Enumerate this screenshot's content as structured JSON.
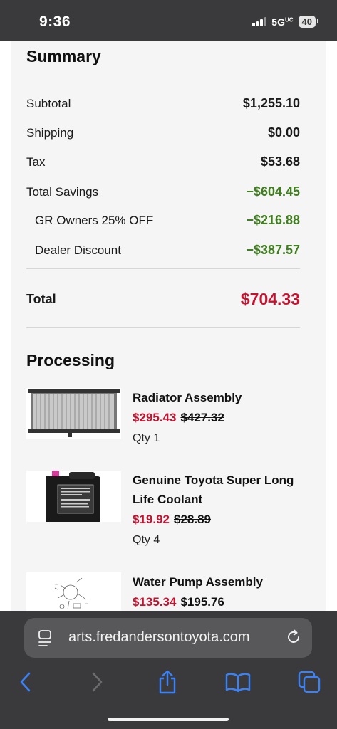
{
  "status_bar": {
    "time": "9:36",
    "network": "5G",
    "network_sup": "UC",
    "battery": "40"
  },
  "summary": {
    "title": "Summary",
    "rows": [
      {
        "label": "Subtotal",
        "value": "$1,255.10"
      },
      {
        "label": "Shipping",
        "value": "$0.00"
      },
      {
        "label": "Tax",
        "value": "$53.68"
      },
      {
        "label": "Total Savings",
        "value": "−$604.45"
      },
      {
        "label": "GR Owners 25% OFF",
        "value": "−$216.88"
      },
      {
        "label": "Dealer Discount",
        "value": "−$387.57"
      }
    ],
    "total_label": "Total",
    "total_value": "$704.33"
  },
  "processing": {
    "title": "Processing",
    "items": [
      {
        "name": "Radiator Assembly",
        "price": "$295.43",
        "original_price": "$427.32",
        "qty": "Qty 1"
      },
      {
        "name": "Genuine Toyota Super Long Life Coolant",
        "price": "$19.92",
        "original_price": "$28.89",
        "qty": "Qty 4"
      },
      {
        "name": "Water Pump Assembly",
        "price": "$135.34",
        "original_price": "$195.76",
        "qty": ""
      }
    ]
  },
  "browser": {
    "url": "arts.fredandersontoyota.com",
    "icons": [
      "page-menu-icon",
      "reload-icon",
      "back-icon",
      "forward-icon",
      "share-icon",
      "bookmarks-icon",
      "tabs-icon"
    ]
  },
  "colors": {
    "accent_red": "#c4122f",
    "savings_green": "#3f7d1f"
  }
}
